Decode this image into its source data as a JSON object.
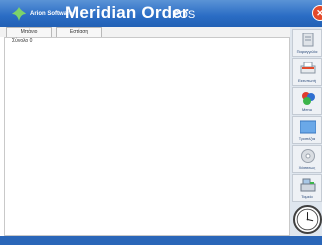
{
  "window": {
    "vendor": "Arion Software",
    "app_name": "Meridian Order",
    "app_suffix": "POS"
  },
  "tabs": [
    "Μπάνιο",
    "Εστίαση"
  ],
  "summary": {
    "label": "Σύνολο 0"
  },
  "sidebar": {
    "items": [
      {
        "label": "Παραγγελία",
        "icon": "document-icon"
      },
      {
        "label": "Εκτυπωτή",
        "icon": "printer-icon"
      },
      {
        "label": "Menu",
        "icon": "menu-balls-icon"
      },
      {
        "label": "Τραπέζια",
        "icon": "table-icon"
      },
      {
        "label": "Χάσσεως",
        "icon": "disc-icon"
      },
      {
        "label": "Ταμείο",
        "icon": "cash-register-icon"
      }
    ]
  },
  "colors": {
    "titlebar": "#2a6cc4",
    "accent": "#e44a2a"
  }
}
